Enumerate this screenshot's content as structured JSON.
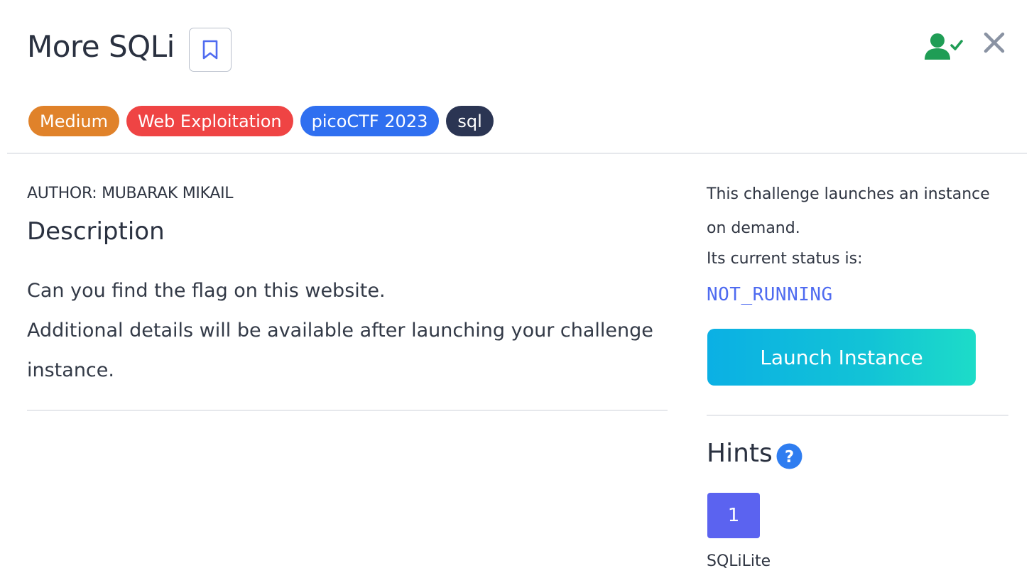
{
  "header": {
    "title": "More SQLi"
  },
  "tags": [
    {
      "label": "Medium",
      "color": "#e0822a"
    },
    {
      "label": "Web Exploitation",
      "color": "#ef4444"
    },
    {
      "label": "picoCTF 2023",
      "color": "#2f6ff0"
    },
    {
      "label": "sql",
      "color": "#2b3553"
    }
  ],
  "challenge": {
    "author": "AUTHOR: MUBARAK MIKAIL",
    "description_heading": "Description",
    "description_lines": [
      "Can you find the flag on this website.",
      "Additional details will be available after launching your challenge instance."
    ]
  },
  "instance": {
    "info": "This challenge launches an instance on demand.",
    "status_label": "Its current status is:",
    "status_value": "NOT_RUNNING",
    "launch_label": "Launch Instance"
  },
  "hints": {
    "heading": "Hints",
    "items": [
      {
        "number": "1",
        "text": "SQLiLite"
      }
    ]
  },
  "colors": {
    "accent_blue": "#4f6bf0",
    "hint_button": "#5b63f0",
    "solved_icon": "#1f9d55",
    "help_icon": "#2f7df0"
  },
  "icons": {
    "bookmark": "bookmark-icon",
    "user_check": "user-check-icon",
    "close": "close-icon",
    "help": "question-circle-icon"
  }
}
